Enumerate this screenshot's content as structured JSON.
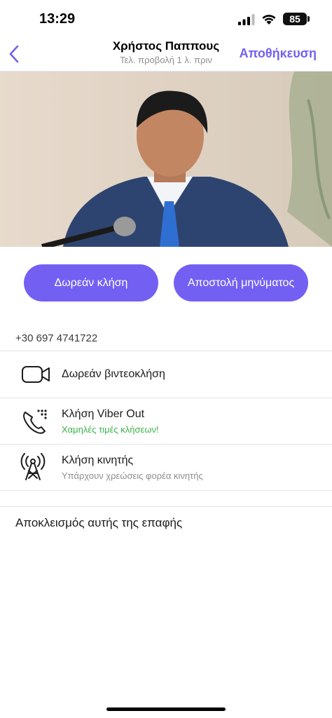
{
  "status_bar": {
    "time": "13:29",
    "battery": "85"
  },
  "header": {
    "name": "Χρήστος Παππους",
    "last_seen": "Τελ. προβολή 1 λ. πριν",
    "save_label": "Αποθήκευση"
  },
  "actions": {
    "free_call": "Δωρεάν κλήση",
    "send_message": "Αποστολή μηνύματος"
  },
  "phone_number": "+30 697 4741722",
  "options": [
    {
      "icon": "video-camera-icon",
      "title": "Δωρεάν βιντεοκλήση",
      "subtitle": ""
    },
    {
      "icon": "viber-out-phone-icon",
      "title": "Κλήση Viber Out",
      "subtitle": "Χαμηλές τιμές κλήσεων!"
    },
    {
      "icon": "cell-tower-icon",
      "title": "Κλήση κινητής",
      "subtitle": "Υπάρχουν χρεώσεις φορέα κινητής"
    }
  ],
  "block_contact": "Αποκλεισμός αυτής της επαφής",
  "colors": {
    "accent": "#7360f2",
    "green": "#3bb24a",
    "subtitle_gray": "#8e8e93"
  }
}
